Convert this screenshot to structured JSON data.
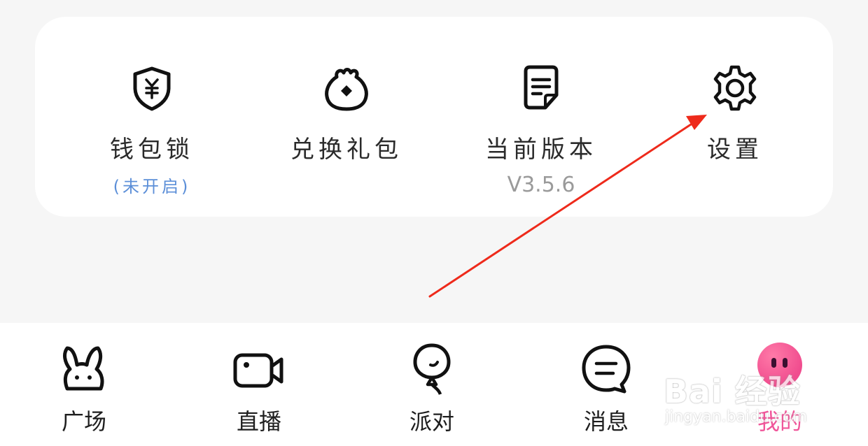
{
  "menu": {
    "items": [
      {
        "label": "钱包锁",
        "sub": "(未开启)",
        "icon": "shield-yuan-icon"
      },
      {
        "label": "兑换礼包",
        "sub": "",
        "icon": "money-bag-icon"
      },
      {
        "label": "当前版本",
        "sub": "V3.5.6",
        "icon": "document-icon"
      },
      {
        "label": "设置",
        "sub": "",
        "icon": "gear-icon"
      }
    ]
  },
  "tabbar": {
    "items": [
      {
        "label": "广场",
        "icon": "bunny-icon"
      },
      {
        "label": "直播",
        "icon": "video-camera-icon"
      },
      {
        "label": "派对",
        "icon": "party-balloon-icon"
      },
      {
        "label": "消息",
        "icon": "chat-bubble-icon"
      },
      {
        "label": "我的",
        "icon": "avatar-icon",
        "active": true
      }
    ]
  },
  "watermark": {
    "brand": "Bai 经验",
    "url": "jingyan.baidu.com"
  },
  "colors": {
    "accent_pink": "#f0569a",
    "sub_blue": "#5c8fd8",
    "arrow_red": "#ee2a1b"
  }
}
